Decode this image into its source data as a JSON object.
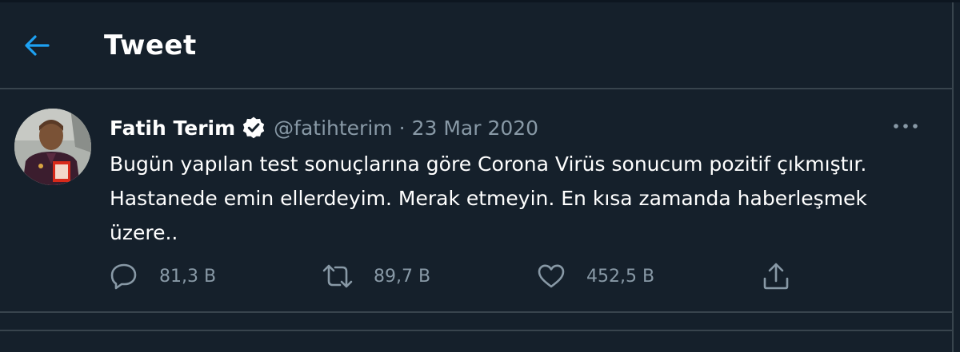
{
  "header": {
    "title": "Tweet"
  },
  "tweet": {
    "author": {
      "display_name": "Fatih Terim",
      "handle": "@fatihterim",
      "verified": true
    },
    "separator": "·",
    "date": "23 Mar 2020",
    "text": "Bugün yapılan test sonuçlarına göre Corona Virüs sonucum pozitif çıkmıştır. Hastanede emin ellerdeyim. Merak etmeyin. En kısa zamanda haberleşmek üzere..",
    "actions": {
      "reply_count": "81,3 B",
      "retweet_count": "89,7 B",
      "like_count": "452,5 B"
    }
  },
  "icons": {
    "back": "arrow-left-icon",
    "verified": "verified-badge-icon",
    "more": "more-options-icon",
    "reply": "reply-icon",
    "retweet": "retweet-icon",
    "like": "heart-icon",
    "share": "share-icon"
  },
  "colors": {
    "background": "#15202b",
    "accent": "#1da1f2",
    "secondary_text": "#8899a6",
    "border": "#38444d",
    "primary_text": "#ffffff"
  }
}
